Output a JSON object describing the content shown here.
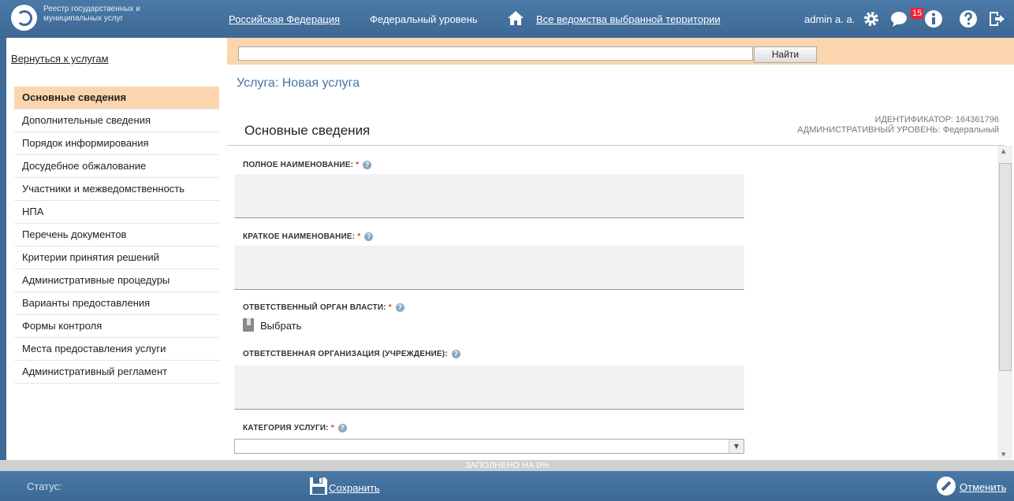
{
  "header": {
    "logo_line1": "Реестр государственных и",
    "logo_line2": "муниципальных услуг",
    "nav": [
      "Российская Федерация",
      "Федеральный уровень",
      "Все ведомства выбранной территории"
    ],
    "user": "admin a. a.",
    "messages_count": "15",
    "icons": [
      "settings-icon",
      "messages-icon",
      "info-icon",
      "help-icon",
      "logout-icon"
    ]
  },
  "sidebar": {
    "back_link": "Вернуться к услугам",
    "items": [
      {
        "label": "Основные сведения",
        "active": true
      },
      {
        "label": "Дополнительные сведения"
      },
      {
        "label": "Порядок информирования"
      },
      {
        "label": "Досудебное обжалование"
      },
      {
        "label": "Участники и межведомственность"
      },
      {
        "label": "НПА"
      },
      {
        "label": "Перечень документов"
      },
      {
        "label": "Критерии принятия решений"
      },
      {
        "label": "Административные процедуры"
      },
      {
        "label": "Варианты предоставления"
      },
      {
        "label": "Формы контроля"
      },
      {
        "label": "Места предоставления услуги"
      },
      {
        "label": "Административный регламент"
      }
    ]
  },
  "search": {
    "value": "",
    "button": "Найти"
  },
  "main": {
    "service_title": "Услуга: Новая услуга",
    "section_title": "Основные сведения",
    "identifier": "ИДЕНТИФИКАТОР: 164361796",
    "admin_level": "АДМИНИСТРАТИВНЫЙ УРОВЕНЬ: Федеральный"
  },
  "form": {
    "full_name_label": "ПОЛНОЕ НАИМЕНОВАНИЕ:",
    "short_name_label": "КРАТКОЕ НАИМЕНОВАНИЕ:",
    "authority_label": "ОТВЕТСТВЕННЫЙ ОРГАН ВЛАСТИ:",
    "select_label": "Выбрать",
    "organization_label": "ОТВЕТСТВЕННАЯ ОРГАНИЗАЦИЯ (УЧРЕЖДЕНИЕ):",
    "category_label": "КАТЕГОРИЯ УСЛУГИ:",
    "required_mark": "*",
    "help_mark": "?"
  },
  "progress": {
    "text": "ЗАПОЛНЕНО НА 0%",
    "percent": 0
  },
  "footer": {
    "status_label": "Статус:",
    "save": "Сохранить",
    "cancel": "Отменить"
  },
  "colors": {
    "accent": "#fbd5ad",
    "header": "#3f6b97",
    "link": "#4a74a0",
    "required": "#ee3333"
  }
}
